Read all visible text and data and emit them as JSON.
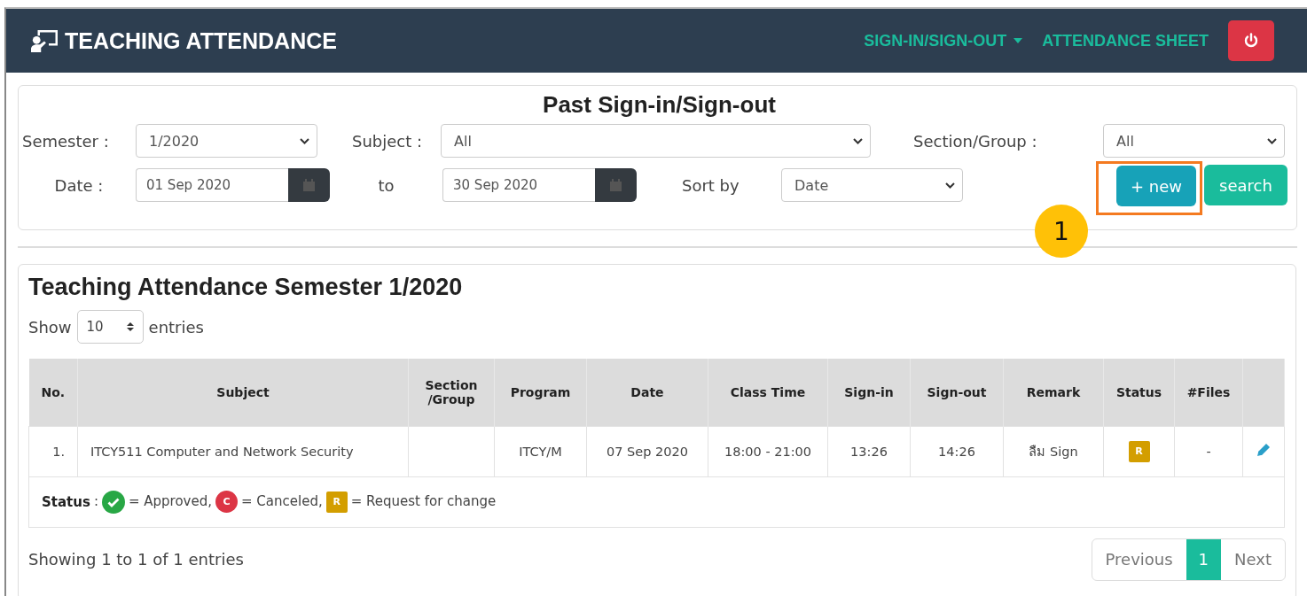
{
  "navbar": {
    "brand": "TEACHING ATTENDANCE",
    "menu": [
      {
        "label": "SIGN-IN/SIGN-OUT",
        "dropdown": true
      },
      {
        "label": "ATTENDANCE SHEET",
        "dropdown": false
      }
    ]
  },
  "filter": {
    "title": "Past Sign-in/Sign-out",
    "semester": {
      "label": "Semester :",
      "value": "1/2020"
    },
    "subject": {
      "label": "Subject :",
      "value": "All"
    },
    "section": {
      "label": "Section/Group :",
      "value": "All"
    },
    "date": {
      "label": "Date :",
      "from": "01 Sep 2020",
      "to_label": "to",
      "to": "30 Sep 2020"
    },
    "sort": {
      "label": "Sort by",
      "value": "Date"
    },
    "buttons": [
      {
        "label": "+ new",
        "kind": "new",
        "highlighted": true
      },
      {
        "label": "search",
        "kind": "search",
        "highlighted": false
      }
    ],
    "callout": "1"
  },
  "table_card": {
    "title": "Teaching Attendance Semester 1/2020",
    "length": {
      "prefix": "Show",
      "value": "10",
      "suffix": "entries"
    },
    "table": {
      "columns": [
        "No.",
        "Subject",
        "Section /Group",
        "Program",
        "Date",
        "Class Time",
        "Sign-in",
        "Sign-out",
        "Remark",
        "Status",
        "#Files"
      ],
      "rows": [
        {
          "no": "1.",
          "subject": "ITCY511 Computer and Network Security",
          "section": "",
          "program": "ITCY/M",
          "date": "07 Sep 2020",
          "class_time": "18:00 - 21:00",
          "sign_in": "13:26",
          "sign_out": "14:26",
          "remark": "ลืม Sign",
          "status": {
            "symbol": "R",
            "color": "#d39e00"
          },
          "files": "-",
          "editable": true
        }
      ]
    },
    "legend": {
      "label": "Status",
      "separator": ":",
      "items": [
        {
          "kind": "check",
          "color": "#28a745",
          "text": "= Approved,"
        },
        {
          "kind": "circle",
          "symbol": "C",
          "color": "#dc3545",
          "text": "= Canceled,"
        },
        {
          "kind": "square",
          "symbol": "R",
          "color": "#d39e00",
          "text": "= Request for change"
        }
      ]
    },
    "info": "Showing 1 to 1 of 1 entries",
    "pagination": [
      {
        "label": "Previous",
        "selected": false
      },
      {
        "label": "1",
        "selected": true
      },
      {
        "label": "Next",
        "selected": false
      }
    ]
  }
}
